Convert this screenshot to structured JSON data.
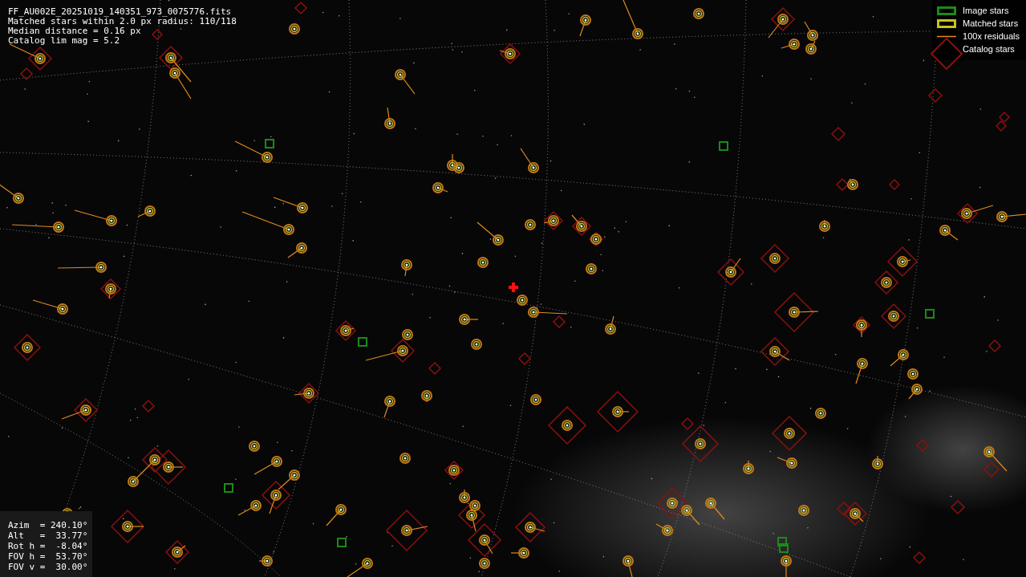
{
  "header_lines": [
    "FF_AU002E_20251019_140351_973_0075776.fits",
    "Matched stars within 2.0 px radius: 110/118",
    "Median distance = 0.16 px",
    "Catalog lim mag = 5.2"
  ],
  "legend": [
    {
      "label": "Image stars",
      "kind": "image"
    },
    {
      "label": "Matched stars",
      "kind": "matched"
    },
    {
      "label": "100x residuals",
      "kind": "residual"
    },
    {
      "label": "Catalog stars",
      "kind": "catalog"
    }
  ],
  "pointing": [
    "Azim  = 240.10°",
    "Alt   =  33.77°",
    "Rot h =  -8.04°",
    "FOV h =  53.70°",
    "FOV v =  30.00°"
  ]
}
